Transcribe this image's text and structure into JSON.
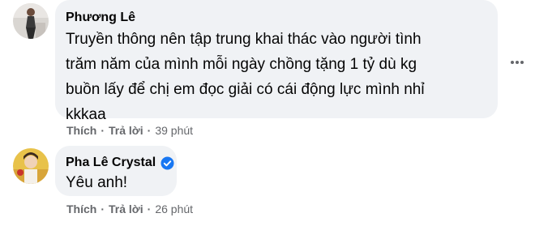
{
  "comments": [
    {
      "author": "Phương Lê",
      "verified": false,
      "text_lines": [
        "Truyền thông nên tập trung khai thác vào người tình",
        "trăm năm của mình mỗi ngày chồng tặng 1 tỷ dù kg",
        "buồn lấy để chị em đọc giải có cái động lực mình nhỉ",
        "kkkaa"
      ],
      "like_label": "Thích",
      "reply_label": "Trả lời",
      "separator": "·",
      "time": "39 phút"
    },
    {
      "author": "Pha Lê Crystal",
      "verified": true,
      "text_lines": [
        "Yêu anh!"
      ],
      "like_label": "Thích",
      "reply_label": "Trả lời",
      "separator": "·",
      "time": "26 phút"
    }
  ],
  "colors": {
    "bubble": "#f0f2f5",
    "meta_text": "#65676b",
    "verified_badge": "#1877f2",
    "primary_text": "#050505"
  },
  "icons": {
    "more": "more-horizontal-icon",
    "verified": "verified-badge-icon"
  }
}
